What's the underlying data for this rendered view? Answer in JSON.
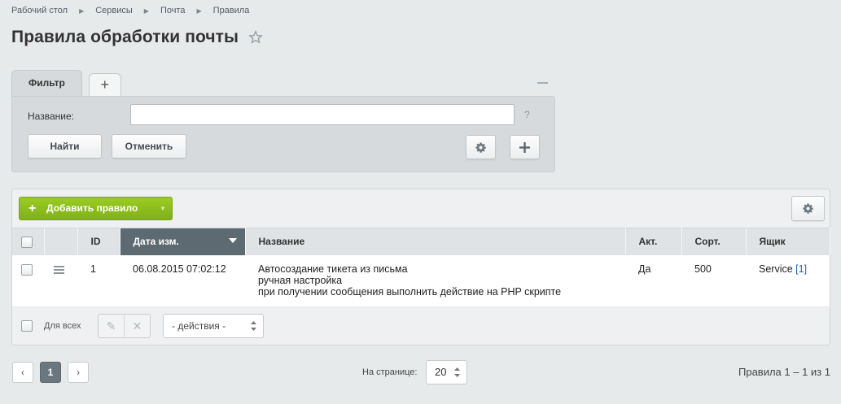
{
  "breadcrumb": [
    "Рабочий стол",
    "Сервисы",
    "Почта",
    "Правила"
  ],
  "page_title": "Правила обработки почты",
  "filter": {
    "tab_label": "Фильтр",
    "add_tab": "+",
    "field_label": "Название:",
    "field_value": "",
    "help": "?",
    "find_label": "Найти",
    "cancel_label": "Отменить"
  },
  "toolbar": {
    "add_rule_label": "Добавить правило",
    "add_plus": "+",
    "caret": "▼"
  },
  "table": {
    "columns": [
      "ID",
      "Дата изм.",
      "Название",
      "Акт.",
      "Сорт.",
      "Ящик"
    ],
    "sorted_column": "Дата изм.",
    "rows": [
      {
        "id": "1",
        "date": "06.08.2015 07:02:12",
        "name_lines": [
          "Автосоздание тикета из письма",
          "ручная настройка",
          "при получении сообщения выполнить действие на PHP скрипте"
        ],
        "active": "Да",
        "sort": "500",
        "mailbox": "Service",
        "mailbox_link": "[1]"
      }
    ]
  },
  "footer": {
    "for_all": "Для всех",
    "actions": "- действия -"
  },
  "pagination": {
    "prev": "‹",
    "current_page": "1",
    "next": "›",
    "per_page_label": "На странице:",
    "per_page_value": "20",
    "total": "Правила 1 – 1 из 1"
  },
  "colors": {
    "accent_green": "#8cbf1f",
    "sorted_header": "#5e6a72",
    "link": "#2067b0"
  }
}
